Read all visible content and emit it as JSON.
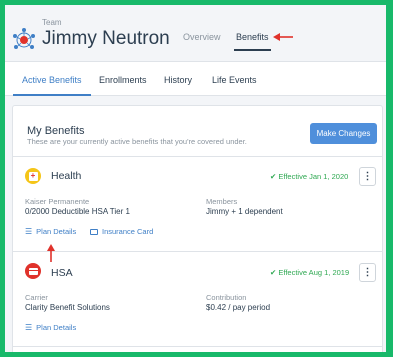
{
  "header": {
    "team_label": "Team",
    "team_name": "Jimmy Neutron",
    "tabs": [
      {
        "label": "Overview",
        "active": false
      },
      {
        "label": "Benefits",
        "active": true
      }
    ]
  },
  "subnav": {
    "tabs": [
      {
        "label": "Active Benefits",
        "active": true
      },
      {
        "label": "Enrollments",
        "active": false
      },
      {
        "label": "History",
        "active": false
      },
      {
        "label": "Life Events",
        "active": false
      }
    ]
  },
  "panel": {
    "title": "My Benefits",
    "subtitle": "These are your currently active benefits that you're covered under.",
    "make_changes_label": "Make Changes"
  },
  "benefits": [
    {
      "name": "Health",
      "icon": "plus-icon",
      "effective": "Effective Jan 1, 2020",
      "left_label": "Kaiser Permanente",
      "left_value": "0/2000 Deductible HSA Tier 1",
      "right_label": "Members",
      "right_value": "Jimmy + 1 dependent",
      "links": [
        "Plan Details",
        "Insurance Card"
      ]
    },
    {
      "name": "HSA",
      "icon": "card-icon",
      "effective": "Effective Aug 1, 2019",
      "left_label": "Carrier",
      "left_value": "Clarity Benefit Solutions",
      "right_label": "Contribution",
      "right_value": "$0.42 / pay period",
      "links": [
        "Plan Details"
      ]
    }
  ],
  "colors": {
    "accent": "#3f7fc6",
    "primary_button": "#4f8fdb",
    "success": "#2fa852",
    "annotation": "#e0322b",
    "health_icon_bg": "#f5c518",
    "hsa_icon_bg": "#e0322b"
  }
}
